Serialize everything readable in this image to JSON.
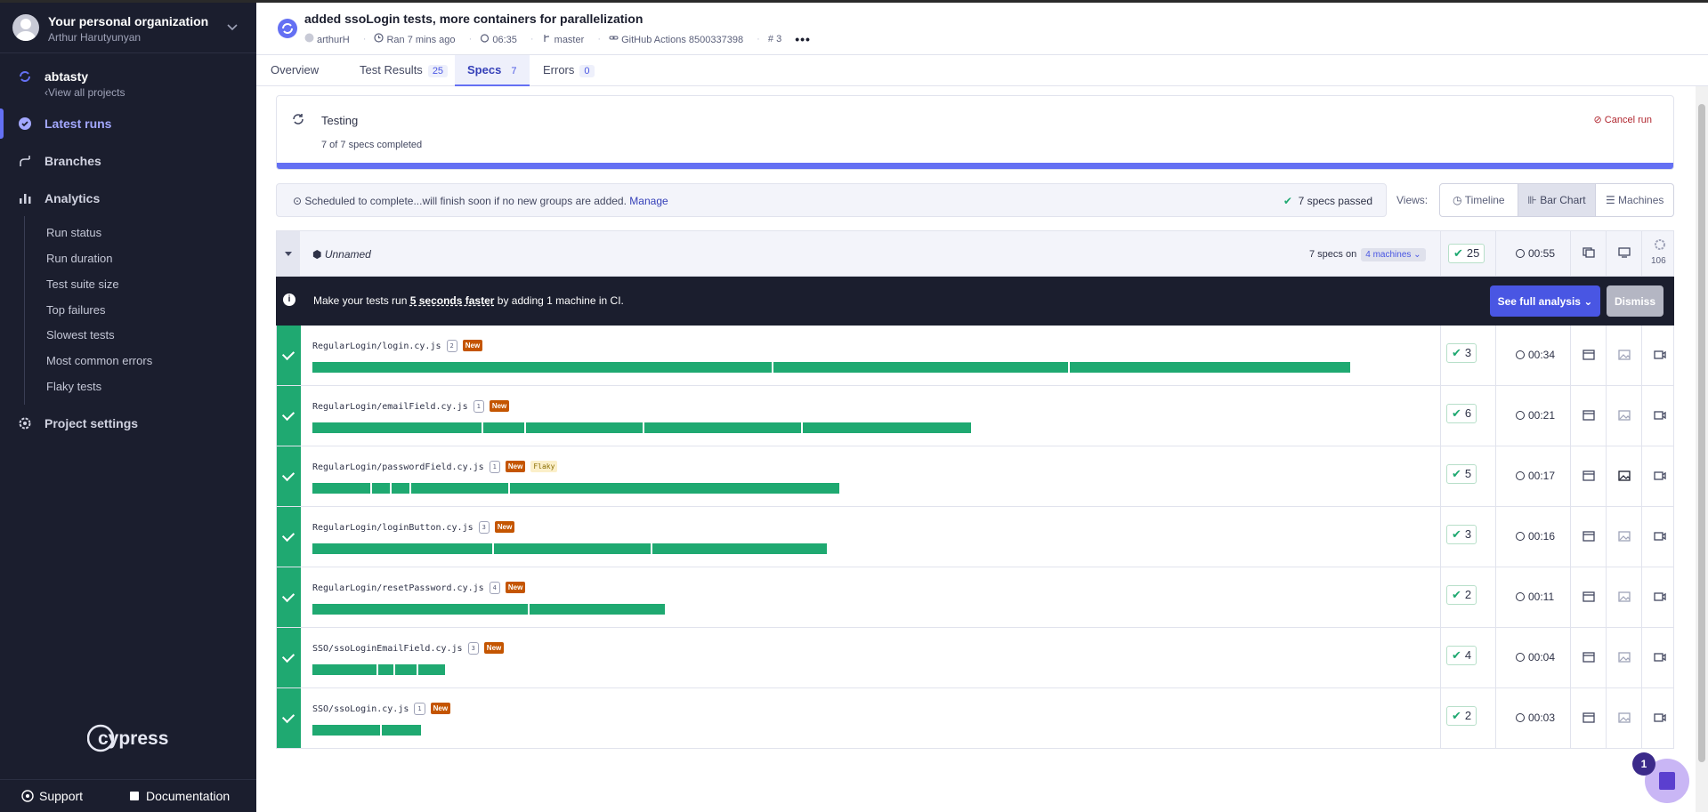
{
  "sidebar": {
    "org_name": "Your personal organization",
    "org_user": "Arthur Harutyunyan",
    "project_name": "abtasty",
    "view_all": "View all projects",
    "nav": [
      {
        "label": "Latest runs",
        "icon": "check-circle-icon"
      },
      {
        "label": "Branches",
        "icon": "branch-icon"
      },
      {
        "label": "Analytics",
        "icon": "bar-chart-icon"
      }
    ],
    "analytics_items": [
      "Run status",
      "Run duration",
      "Test suite size",
      "Top failures",
      "Slowest tests",
      "Most common errors",
      "Flaky tests"
    ],
    "settings": "Project settings",
    "logo_text": "cypress",
    "support": "Support",
    "documentation": "Documentation"
  },
  "header": {
    "title": "added ssoLogin tests, more containers for parallelization",
    "author": "arthurH",
    "ran": "Ran 7 mins ago",
    "duration": "06:35",
    "branch": "master",
    "ci": "GitHub Actions 8500337398",
    "run_number": "3",
    "more": "•••"
  },
  "tabs": [
    {
      "label": "Overview",
      "count": null
    },
    {
      "label": "Test Results",
      "count": "25"
    },
    {
      "label": "Specs",
      "count": "7"
    },
    {
      "label": "Errors",
      "count": "0"
    }
  ],
  "status_card": {
    "title": "Testing",
    "subtitle": "7 of 7 specs completed",
    "cancel": "Cancel run",
    "progress": 1.0
  },
  "schedule": {
    "text": "Scheduled to complete...will finish soon if no new groups are added.",
    "link": "Manage",
    "passed": "7 specs passed"
  },
  "views": {
    "label": "Views:",
    "options": [
      "Timeline",
      "Bar Chart",
      "Machines"
    ],
    "selected": "Bar Chart"
  },
  "group": {
    "name": "Unnamed",
    "specs_on": "7 specs on",
    "machines": "4 machines",
    "passed": "25",
    "duration": "00:55",
    "flake_count": "106"
  },
  "banner": {
    "pre": "Make your tests run",
    "highlight": "5 seconds faster",
    "post": "by adding 1 machine in CI.",
    "full_analysis": "See full analysis",
    "dismiss": "Dismiss"
  },
  "specs": [
    {
      "file": "RegularLogin/login.cy.js",
      "machine": "2",
      "new": "New",
      "flaky": null,
      "passed": "3",
      "duration": "00:34",
      "bars": [
        14,
        9,
        8.5
      ]
    },
    {
      "file": "RegularLogin/emailField.cy.js",
      "machine": "1",
      "new": "New",
      "flaky": null,
      "passed": "6",
      "duration": "00:21",
      "bars": [
        5.2,
        1.3,
        3.6,
        4.8,
        5.1
      ]
    },
    {
      "file": "RegularLogin/passwordField.cy.js",
      "machine": "1",
      "new": "New",
      "flaky": "Flaky",
      "passed": "5",
      "duration": "00:17",
      "bars": [
        1.8,
        0.6,
        0.6,
        3,
        10
      ]
    },
    {
      "file": "RegularLogin/loginButton.cy.js",
      "machine": "3",
      "new": "New",
      "flaky": null,
      "passed": "3",
      "duration": "00:16",
      "bars": [
        5.5,
        4.8,
        5.3
      ]
    },
    {
      "file": "RegularLogin/resetPassword.cy.js",
      "machine": "4",
      "new": "New",
      "flaky": null,
      "passed": "2",
      "duration": "00:11",
      "bars": [
        6.6,
        4.1
      ]
    },
    {
      "file": "SSO/ssoLoginEmailField.cy.js",
      "machine": "3",
      "new": "New",
      "flaky": null,
      "passed": "4",
      "duration": "00:04",
      "bars": [
        2,
        0.5,
        0.7,
        0.8
      ]
    },
    {
      "file": "SSO/ssoLogin.cy.js",
      "machine": "1",
      "new": "New",
      "flaky": null,
      "passed": "2",
      "duration": "00:03",
      "bars": [
        2.1,
        1.2
      ]
    }
  ],
  "help_badge": "1"
}
